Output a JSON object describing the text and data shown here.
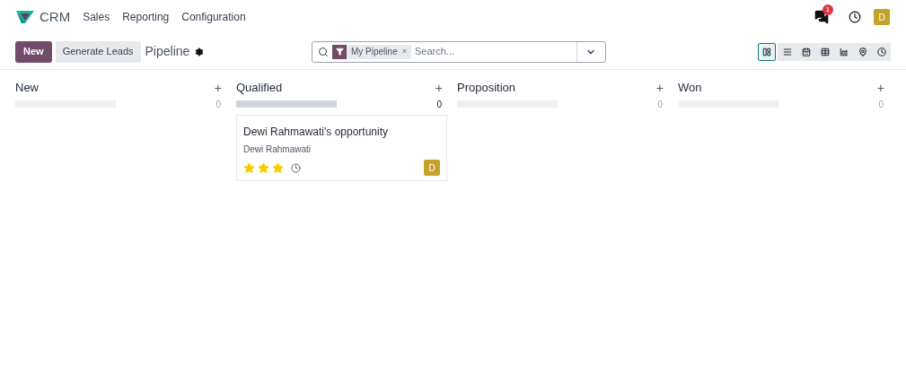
{
  "navbar": {
    "app_name": "CRM",
    "menu": [
      "Sales",
      "Reporting",
      "Configuration"
    ],
    "messages_badge": "1",
    "user_initial": "D"
  },
  "control_panel": {
    "new_button": "New",
    "generate_button": "Generate Leads",
    "breadcrumb": "Pipeline",
    "search": {
      "facet": "My Pipeline",
      "facet_remove": "×",
      "placeholder": "Search..."
    },
    "views": [
      {
        "kind": "kanban",
        "selected": true
      },
      {
        "kind": "list",
        "selected": false
      },
      {
        "kind": "calendar",
        "selected": false
      },
      {
        "kind": "pivot",
        "selected": false
      },
      {
        "kind": "graph",
        "selected": false
      },
      {
        "kind": "map",
        "selected": false
      },
      {
        "kind": "activity",
        "selected": false
      }
    ]
  },
  "columns": [
    {
      "title": "New",
      "add": "+",
      "count": "0",
      "has_records": false
    },
    {
      "title": "Qualified",
      "add": "+",
      "count": "0",
      "has_records": true,
      "cards": [
        {
          "title": "Dewi Rahmawati's opportunity",
          "contact": "Dewi Rahmawati",
          "stars": 3,
          "avatar": "D"
        }
      ]
    },
    {
      "title": "Proposition",
      "add": "+",
      "count": "0",
      "has_records": false
    },
    {
      "title": "Won",
      "add": "+",
      "count": "0",
      "has_records": false
    }
  ]
}
